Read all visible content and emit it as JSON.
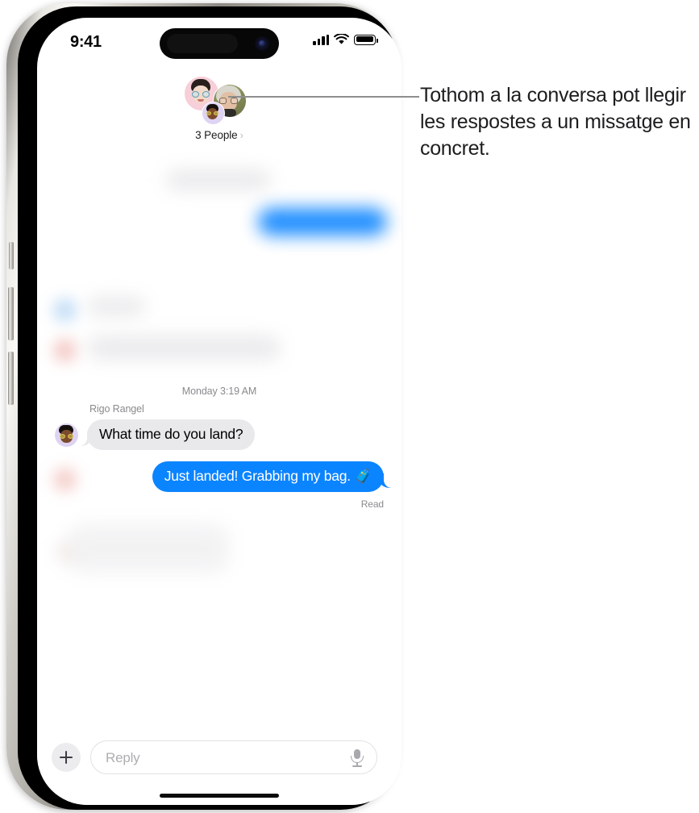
{
  "status_bar": {
    "time": "9:41",
    "signal_icon": "cellular-signal-icon",
    "wifi_icon": "wifi-icon",
    "battery_icon": "battery-full-icon"
  },
  "conversation_header": {
    "participants_label": "3 People",
    "chevron": "›",
    "avatars": [
      {
        "name": "memoji-avatar-pink",
        "background": "#f7cfd9"
      },
      {
        "name": "photo-avatar-olive",
        "background": "#848a58"
      },
      {
        "name": "memoji-avatar-purple",
        "background": "#ded3f2"
      }
    ]
  },
  "messages": {
    "timestamp_divider": "Monday 3:19 AM",
    "sender_name": "Rigo Rangel",
    "incoming_text": "What time do you land?",
    "outgoing_text": "Just landed! Grabbing my bag. 🧳",
    "delivery_status": "Read",
    "bubble_colors": {
      "incoming": "#e9e9eb",
      "outgoing": "#0b84ff"
    }
  },
  "input_bar": {
    "add_label": "+",
    "reply_placeholder": "Reply",
    "mic_icon": "microphone-icon"
  },
  "callout": {
    "text": "Tothom a la conversa pot llegir les respostes a un missatge en concret."
  }
}
